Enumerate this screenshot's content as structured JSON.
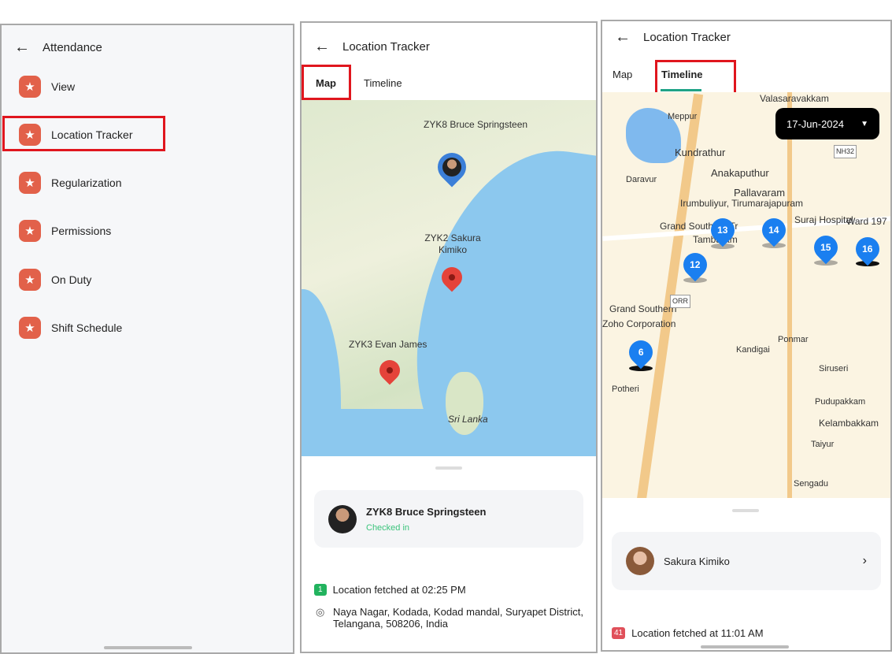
{
  "panel1": {
    "title": "Attendance",
    "items": [
      {
        "label": "View",
        "icon": "star-badge-icon"
      },
      {
        "label": "Location Tracker",
        "icon": "star-badge-icon",
        "highlighted": true
      },
      {
        "label": "Regularization",
        "icon": "star-badge-icon"
      },
      {
        "label": "Permissions",
        "icon": "star-badge-icon"
      },
      {
        "label": "On Duty",
        "icon": "star-badge-icon"
      },
      {
        "label": "Shift Schedule",
        "icon": "star-badge-icon"
      }
    ]
  },
  "panel2": {
    "title": "Location Tracker",
    "tabs": [
      {
        "label": "Map",
        "active": true
      },
      {
        "label": "Timeline"
      }
    ],
    "map": {
      "labels": [
        "ZYK8 Bruce Springsteen",
        "ZYK2 Sakura Kimiko",
        "ZYK3 Evan James",
        "Sri Lanka"
      ]
    },
    "card": {
      "name": "ZYK8 Bruce Springsteen",
      "status": "Checked in"
    },
    "fetch": {
      "badge": "1",
      "text": "Location fetched at 02:25 PM",
      "address": "Naya Nagar, Kodada, Kodad mandal, Suryapet District, Telangana, 508206, India"
    },
    "colors": {
      "status": "#3cc47c",
      "badge": "#22b35e",
      "pin_red": "#e5433a",
      "pin_blue": "#3b7fd8"
    }
  },
  "panel3": {
    "title": "Location Tracker",
    "tabs": [
      {
        "label": "Map"
      },
      {
        "label": "Timeline",
        "active": true
      }
    ],
    "date": "17-Jun-2024",
    "map": {
      "places": [
        "Valasaravakkam",
        "Meppur",
        "Kundrathur",
        "Anakaputhur",
        "Daravur",
        "Pallavaram",
        "Irumbuliyur, Tirumarajapuram",
        "Grand Southern Tr",
        "Tambaram",
        "Suraj Hospital",
        "Ward 197",
        "Grand Southern",
        "Zoho Corporation",
        "Ponmar",
        "Kandigai",
        "Siruseri",
        "Potheri",
        "Pudupakkam",
        "Kelambakkam",
        "Taiyur",
        "Sengadu",
        "NH32",
        "ORR"
      ],
      "pins": [
        "13",
        "14",
        "15",
        "16",
        "12",
        "6"
      ]
    },
    "card": {
      "name": "Sakura Kimiko"
    },
    "fetch": {
      "badge": "41",
      "text": "Location fetched at 11:01 AM"
    },
    "colors": {
      "pin": "#1a7ff0",
      "tab_underline": "#1fa386",
      "badge": "#e0505a",
      "date_bg": "#000000"
    }
  }
}
